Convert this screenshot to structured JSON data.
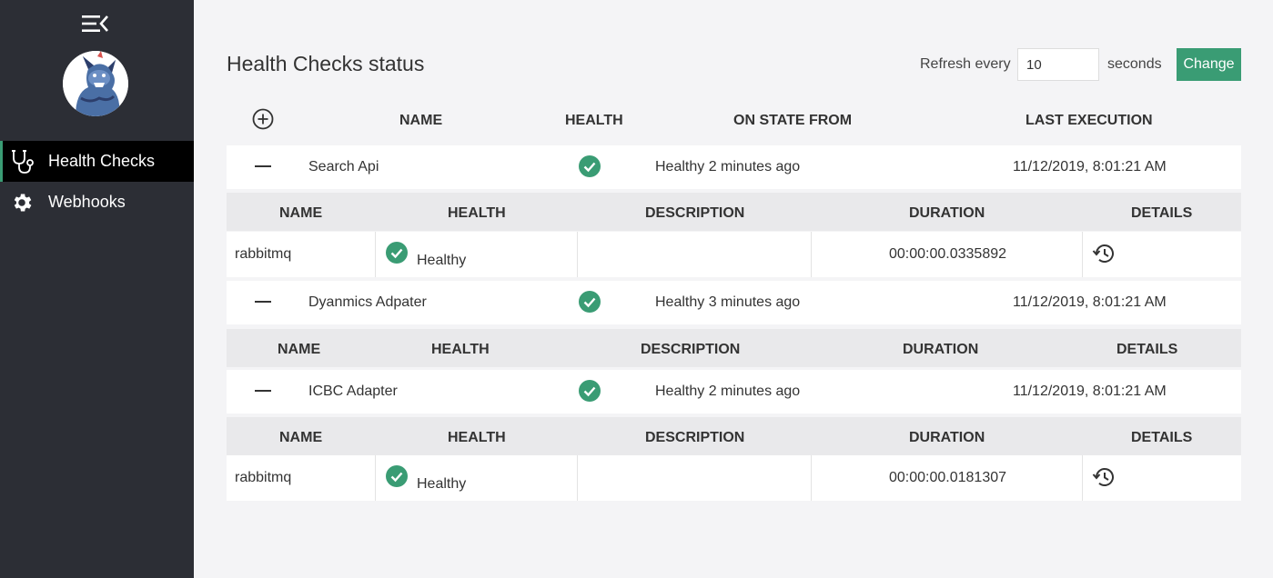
{
  "sidebar": {
    "toggle_icon": "menu-collapse-icon",
    "logo_icon": "mascot-logo",
    "items": [
      {
        "label": "Health Checks",
        "icon": "stethoscope-icon",
        "active": true
      },
      {
        "label": "Webhooks",
        "icon": "gear-icon",
        "active": false
      }
    ]
  },
  "header": {
    "title": "Health Checks status",
    "refresh_label": "Refresh every",
    "refresh_value": "10",
    "seconds_label": "seconds",
    "change_label": "Change"
  },
  "table": {
    "columns": [
      "NAME",
      "HEALTH",
      "ON STATE FROM",
      "LAST EXECUTION"
    ],
    "sub_columns": [
      "NAME",
      "HEALTH",
      "DESCRIPTION",
      "DURATION",
      "DETAILS"
    ],
    "rows": [
      {
        "name": "Search Api",
        "health_icon": "check-circle-icon",
        "state": "Healthy 2 minutes ago",
        "last": "11/12/2019, 8:01:21 AM",
        "entries": [
          {
            "name": "rabbitmq",
            "health": "Healthy",
            "description": "",
            "duration": "00:00:00.0335892"
          }
        ]
      },
      {
        "name": "Dyanmics Adpater",
        "health_icon": "check-circle-icon",
        "state": "Healthy 3 minutes ago",
        "last": "11/12/2019, 8:01:21 AM",
        "entries": []
      },
      {
        "name": "ICBC Adapter",
        "health_icon": "check-circle-icon",
        "state": "Healthy 2 minutes ago",
        "last": "11/12/2019, 8:01:21 AM",
        "entries": [
          {
            "name": "rabbitmq",
            "health": "Healthy",
            "description": "",
            "duration": "00:00:00.0181307"
          }
        ]
      }
    ]
  },
  "colors": {
    "sidebar_bg": "#2c2e35",
    "accent": "#3a9c74",
    "healthy": "#3a9c74"
  }
}
